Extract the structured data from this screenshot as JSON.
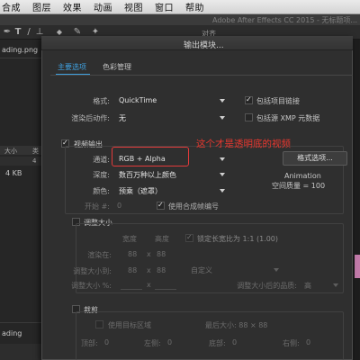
{
  "menubar": {
    "items": [
      "合成",
      "图层",
      "效果",
      "动画",
      "视图",
      "窗口",
      "帮助"
    ]
  },
  "window": {
    "title": "Adobe After Effects CC 2015 - 无标题项..."
  },
  "toolbar": {
    "tools": [
      {
        "icon": "pen-icon",
        "glyph": "✒"
      },
      {
        "icon": "text-tool-icon",
        "glyph": "T"
      },
      {
        "icon": "brush-icon",
        "glyph": "/"
      },
      {
        "icon": "stamp-icon",
        "glyph": "⊥"
      },
      {
        "icon": "eraser-icon",
        "glyph": "◆"
      },
      {
        "icon": "roto-brush-icon",
        "glyph": "✎"
      },
      {
        "icon": "puppet-pin-icon",
        "glyph": "✦"
      }
    ],
    "align_label": "对齐"
  },
  "project_panel": {
    "file_name": "ading.png",
    "size_header": "大小",
    "type_header": "类",
    "count": "4",
    "file_size": "4 KB",
    "bottom_label": "ading"
  },
  "dialog": {
    "title": "输出模块...",
    "tabs": {
      "main": "主要选项",
      "color": "色彩管理"
    },
    "format": {
      "label": "格式:",
      "value": "QuickTime"
    },
    "include_project_link": {
      "label": "包括项目链接",
      "checked": true
    },
    "post_render": {
      "label": "渲染后动作:",
      "value": "无"
    },
    "include_xmp": {
      "label": "包括源 XMP 元数据",
      "checked": false
    },
    "video_output": {
      "label": "视频输出",
      "checked": true,
      "channels": {
        "label": "通道:",
        "value": "RGB + Alpha"
      },
      "depth": {
        "label": "深度:",
        "value": "数百万种以上颜色"
      },
      "color": {
        "label": "颜色:",
        "value": "预乘（遮罩）"
      },
      "start": {
        "label": "开始 #:",
        "value": "0"
      },
      "use_comp_frame": {
        "label": "使用合成帧编号",
        "checked": true
      },
      "format_options_button": "格式选项...",
      "codec_name": "Animation",
      "spatial_quality": "空间质量 = 100"
    },
    "annotation": "这个才是透明底的视频",
    "resize": {
      "label": "调整大小",
      "checked": false,
      "width_header": "宽度",
      "height_header": "高度",
      "lock_aspect_label": "锁定长宽比为 1:1 (1.00)",
      "lock_aspect_checked": true,
      "render_at": {
        "label": "渲染在:",
        "width": "88",
        "x": "x",
        "height": "88"
      },
      "resize_to": {
        "label": "调整大小到:",
        "width": "88",
        "x": "x",
        "height": "88",
        "preset": "自定义"
      },
      "resize_percent": {
        "label": "调整大小 %:",
        "x": "x"
      },
      "quality": {
        "label": "调整大小后的品质:",
        "value": "高"
      }
    },
    "crop": {
      "label": "裁剪",
      "checked": false,
      "use_roi": {
        "label": "使用目标区域",
        "checked": false
      },
      "final_size": "最后大小: 88 × 88",
      "top": {
        "label": "顶部:",
        "value": "0"
      },
      "left": {
        "label": "左侧:",
        "value": "0"
      },
      "bottom": {
        "label": "底部:",
        "value": "0"
      },
      "right": {
        "label": "右侧:",
        "value": "0"
      }
    }
  },
  "colors": {
    "accent_blue": "#3fa1e0",
    "annotation_red": "#e8372f",
    "dialog_bg": "#2f2f2f"
  }
}
